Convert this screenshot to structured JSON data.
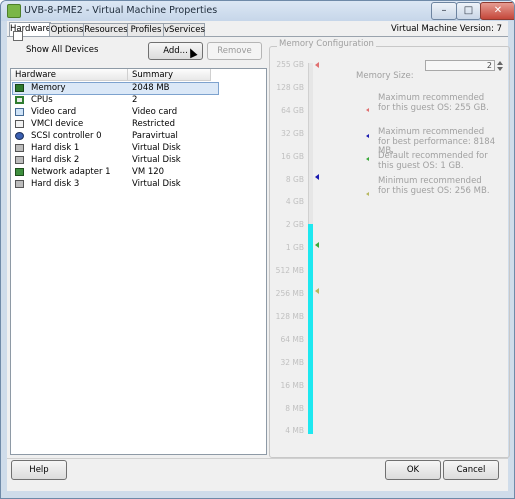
{
  "window": {
    "title": "UVB-8-PME2 - Virtual Machine Properties",
    "controls": {
      "minimize": "–",
      "maximize": "□",
      "close": "✕"
    }
  },
  "tabs": [
    {
      "label": "Hardware",
      "active": true
    },
    {
      "label": "Options"
    },
    {
      "label": "Resources"
    },
    {
      "label": "Profiles"
    },
    {
      "label": "vServices"
    }
  ],
  "vm_version": "Virtual Machine Version: 7",
  "hardware_panel": {
    "show_all_devices_label": "Show All Devices",
    "show_all_devices_checked": false,
    "add_button": "Add...",
    "remove_button": "Remove",
    "columns": [
      "Hardware",
      "Summary"
    ],
    "rows": [
      {
        "hardware": "Memory",
        "summary": "2048 MB",
        "icon": "memory-icon",
        "selected": true
      },
      {
        "hardware": "CPUs",
        "summary": "2",
        "icon": "cpu-icon"
      },
      {
        "hardware": "Video card",
        "summary": "Video card",
        "icon": "video-card-icon"
      },
      {
        "hardware": "VMCI device",
        "summary": "Restricted",
        "icon": "vmci-device-icon"
      },
      {
        "hardware": "SCSI controller 0",
        "summary": "Paravirtual",
        "icon": "scsi-controller-icon"
      },
      {
        "hardware": "Hard disk 1",
        "summary": "Virtual Disk",
        "icon": "hard-disk-icon"
      },
      {
        "hardware": "Hard disk 2",
        "summary": "Virtual Disk",
        "icon": "hard-disk-icon"
      },
      {
        "hardware": "Network adapter 1",
        "summary": "VM 120",
        "icon": "network-adapter-icon"
      },
      {
        "hardware": "Hard disk 3",
        "summary": "Virtual Disk",
        "icon": "hard-disk-icon"
      }
    ]
  },
  "memory_config": {
    "title": "Memory Configuration",
    "scale_labels": [
      "255 GB",
      "128 GB",
      "64 GB",
      "32 GB",
      "16 GB",
      "8 GB",
      "4 GB",
      "2 GB",
      "1 GB",
      "512 MB",
      "256 MB",
      "128 MB",
      "64 MB",
      "32 MB",
      "16 MB",
      "8 MB",
      "4 MB"
    ],
    "memory_size_label": "Memory Size:",
    "memory_size_value": "2",
    "slider_level_label": "2 GB",
    "info": [
      {
        "text": "Maximum recommended for this guest OS: 255 GB.",
        "color": "#e07070"
      },
      {
        "text": "Maximum recommended for best performance: 8184 MB.",
        "color": "#1a1ab0"
      },
      {
        "text": "Default recommended for this guest OS: 1 GB.",
        "color": "#3aaa3a"
      },
      {
        "text": "Minimum recommended for this guest OS: 256 MB.",
        "color": "#b8b860"
      }
    ],
    "fill_color": "#1ee8f0"
  },
  "footer": {
    "help_button": "Help",
    "ok_button": "OK",
    "cancel_button": "Cancel"
  }
}
